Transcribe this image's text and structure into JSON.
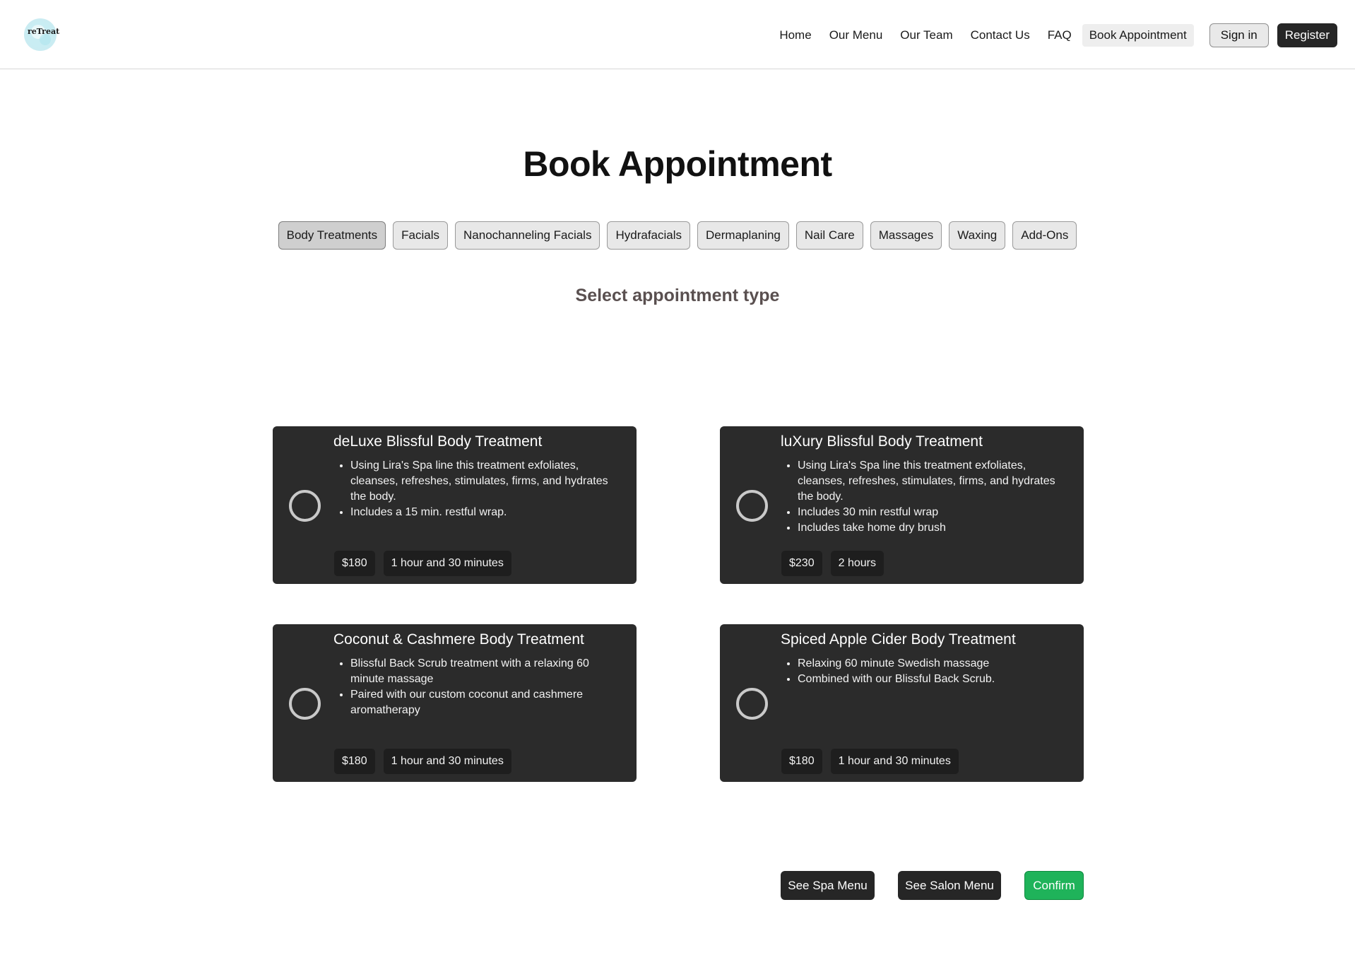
{
  "header": {
    "logo_text": "reTreat",
    "nav": [
      "Home",
      "Our Menu",
      "Our Team",
      "Contact Us",
      "FAQ",
      "Book Appointment"
    ],
    "active_nav": "Book Appointment",
    "signin_label": "Sign in",
    "register_label": "Register"
  },
  "page": {
    "title": "Book Appointment",
    "subtitle": "Select appointment type"
  },
  "tabs": [
    "Body Treatments",
    "Facials",
    "Nanochanneling Facials",
    "Hydrafacials",
    "Dermaplaning",
    "Nail Care",
    "Massages",
    "Waxing",
    "Add-Ons"
  ],
  "active_tab": "Body Treatments",
  "cards": [
    {
      "title": "deLuxe Blissful Body Treatment",
      "bullets": [
        "Using Lira's Spa line this treatment exfoliates, cleanses, refreshes, stimulates, firms, and hydrates the body.",
        "Includes a 15 min. restful wrap."
      ],
      "price": "$180",
      "duration": "1 hour and 30 minutes",
      "selected": false
    },
    {
      "title": "luXury Blissful Body Treatment",
      "bullets": [
        "Using Lira's Spa line this treatment exfoliates, cleanses, refreshes, stimulates, firms, and hydrates the body.",
        "Includes 30 min restful wrap",
        "Includes take home dry brush"
      ],
      "price": "$230",
      "duration": "2 hours",
      "selected": false
    },
    {
      "title": "Coconut & Cashmere Body Treatment",
      "bullets": [
        "Blissful Back Scrub treatment with a relaxing 60 minute massage",
        "Paired with our custom coconut and cashmere aromatherapy"
      ],
      "price": "$180",
      "duration": "1 hour and 30 minutes",
      "selected": false
    },
    {
      "title": "Spiced Apple Cider Body Treatment",
      "bullets": [
        "Relaxing 60 minute Swedish massage",
        "Combined with our Blissful Back Scrub."
      ],
      "price": "$180",
      "duration": "1 hour and 30 minutes",
      "selected": false
    }
  ],
  "actions": {
    "spa_menu": "See Spa Menu",
    "salon_menu": "See Salon Menu",
    "confirm": "Confirm"
  },
  "colors": {
    "card_bg": "#2b2b2b",
    "confirm_green": "#1fb35a",
    "dark_button": "#262626"
  }
}
